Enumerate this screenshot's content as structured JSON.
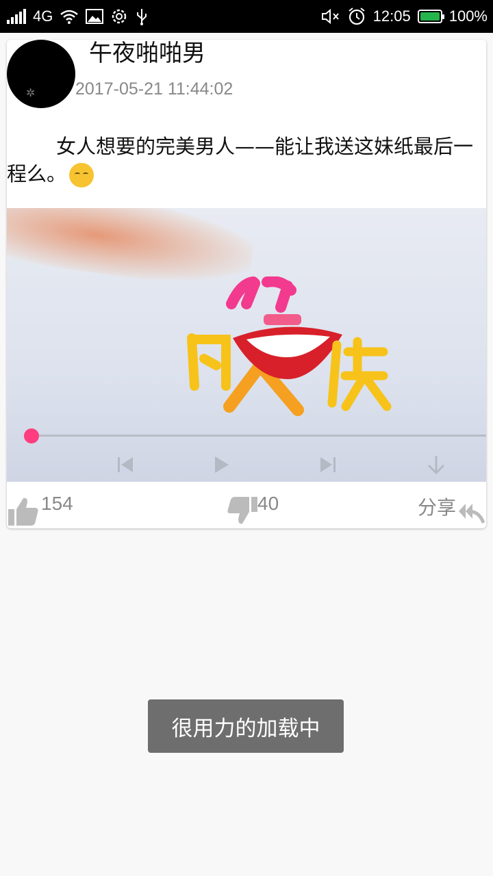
{
  "status_bar": {
    "network": "4G",
    "time": "12:05",
    "battery": "100%"
  },
  "post": {
    "username": "午夜啪啪男",
    "timestamp": "2017-05-21 11:44:02",
    "text": "女人想要的完美男人——能让我送这妹纸最后一程么。",
    "emoji": "smirk-emoji-icon"
  },
  "video": {
    "logo_text": "闪笑侠",
    "progress": 0
  },
  "actions": {
    "likes": "154",
    "dislikes": "40",
    "share": "分享"
  },
  "toast": {
    "message": "很用力的加载中"
  }
}
